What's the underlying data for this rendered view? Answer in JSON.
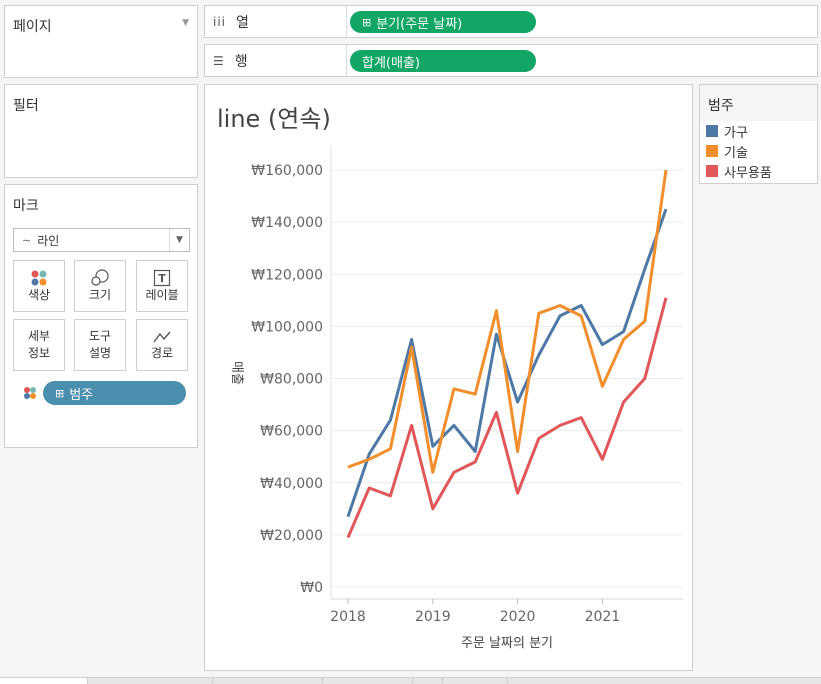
{
  "pages_panel": {
    "title": "페이지"
  },
  "filters_panel": {
    "title": "필터"
  },
  "marks_panel": {
    "title": "마크",
    "mark_type": "라인",
    "buttons": {
      "color": "색상",
      "size": "크기",
      "label": "레이블",
      "detail_1": "세부",
      "detail_2": "정보",
      "tooltip_1": "도구",
      "tooltip_2": "설명",
      "path": "경로"
    },
    "color_pill": "범주"
  },
  "columns_shelf": {
    "label": "열",
    "pill": "분기(주문 날짜)"
  },
  "rows_shelf": {
    "label": "행",
    "pill": "합계(매출)"
  },
  "legend": {
    "title": "범주",
    "items": [
      {
        "label": "가구",
        "color": "#4e79a7"
      },
      {
        "label": "기술",
        "color": "#f28e2b"
      },
      {
        "label": "사무용품",
        "color": "#e15759"
      }
    ]
  },
  "view": {
    "title": "line (연속)"
  },
  "chart_data": {
    "type": "line",
    "title": "line (연속)",
    "xlabel": "주문 날짜의 분기",
    "ylabel": "매출",
    "x": [
      "2018 Q1",
      "2018 Q2",
      "2018 Q3",
      "2018 Q4",
      "2019 Q1",
      "2019 Q2",
      "2019 Q3",
      "2019 Q4",
      "2020 Q1",
      "2020 Q2",
      "2020 Q3",
      "2020 Q4",
      "2021 Q1",
      "2021 Q2",
      "2021 Q3",
      "2021 Q4"
    ],
    "x_ticks": [
      "2018",
      "2019",
      "2020",
      "2021"
    ],
    "y_ticks": [
      "₩0",
      "₩20,000",
      "₩40,000",
      "₩60,000",
      "₩80,000",
      "₩100,000",
      "₩120,000",
      "₩140,000",
      "₩160,000"
    ],
    "ylim": [
      0,
      160000
    ],
    "grid": true,
    "series": [
      {
        "name": "가구",
        "color": "#4e79a7",
        "values": [
          27000,
          51000,
          64000,
          95000,
          54000,
          62000,
          52000,
          97000,
          71000,
          89000,
          104000,
          108000,
          93000,
          98000,
          122000,
          145000
        ]
      },
      {
        "name": "기술",
        "color": "#f28e2b",
        "values": [
          46000,
          49000,
          53000,
          92000,
          44000,
          76000,
          74000,
          106000,
          52000,
          105000,
          108000,
          104000,
          77000,
          95000,
          102000,
          160000
        ]
      },
      {
        "name": "사무용품",
        "color": "#e15759",
        "values": [
          19000,
          38000,
          35000,
          62000,
          30000,
          44000,
          48000,
          67000,
          36000,
          57000,
          62000,
          65000,
          49000,
          71000,
          80000,
          111000
        ]
      }
    ]
  }
}
